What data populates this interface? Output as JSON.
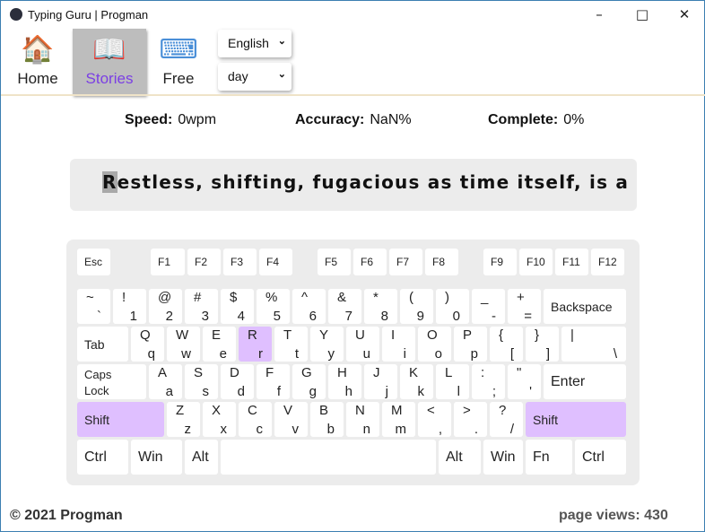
{
  "window": {
    "title": "Typing Guru | Progman",
    "icons": [
      "app-logo-icon",
      "minimize-icon",
      "maximize-icon",
      "close-icon"
    ]
  },
  "nav": [
    {
      "label": "Home",
      "icon": "house-icon",
      "glyph": "🏠",
      "active": false
    },
    {
      "label": "Stories",
      "icon": "storybook-icon",
      "glyph": "📖",
      "active": true
    },
    {
      "label": "Free",
      "icon": "keyboard-hands-icon",
      "glyph": "⌨",
      "active": false
    }
  ],
  "selects": {
    "language": "English",
    "theme": "day"
  },
  "stats": {
    "speed_label": "Speed:",
    "speed": "0wpm",
    "accuracy_label": "Accuracy:",
    "accuracy": "NaN%",
    "complete_label": "Complete:",
    "complete": "0%"
  },
  "text": {
    "current_char": "R",
    "rest": "estless, shifting, fugacious as time itself, is a"
  },
  "colors": {
    "highlight": "#dfbfff",
    "active_nav_text": "#7b3fe4",
    "cursor": "#a9a9a9"
  },
  "keyboard": {
    "rows": [
      [
        {
          "l": "Esc"
        },
        {
          "l": "F1"
        },
        {
          "l": "F2"
        },
        {
          "l": "F3"
        },
        {
          "l": "F4"
        },
        {
          "l": "F5"
        },
        {
          "l": "F6"
        },
        {
          "l": "F7"
        },
        {
          "l": "F8"
        },
        {
          "l": "F9"
        },
        {
          "l": "F10"
        },
        {
          "l": "F11"
        },
        {
          "l": "F12"
        }
      ],
      [
        {
          "t": "~",
          "b": "`"
        },
        {
          "t": "!",
          "b": "1"
        },
        {
          "t": "@",
          "b": "2"
        },
        {
          "t": "#",
          "b": "3"
        },
        {
          "t": "$",
          "b": "4"
        },
        {
          "t": "%",
          "b": "5"
        },
        {
          "t": "^",
          "b": "6"
        },
        {
          "t": "&",
          "b": "7"
        },
        {
          "t": "*",
          "b": "8"
        },
        {
          "t": "(",
          "b": "9"
        },
        {
          "t": ")",
          "b": "0"
        },
        {
          "t": "_",
          "b": "-"
        },
        {
          "t": "+",
          "b": "="
        },
        {
          "l": "Backspace"
        }
      ],
      [
        {
          "l": "Tab"
        },
        {
          "t": "Q",
          "b": "q"
        },
        {
          "t": "W",
          "b": "w"
        },
        {
          "t": "E",
          "b": "e"
        },
        {
          "t": "R",
          "b": "r",
          "hl": true
        },
        {
          "t": "T",
          "b": "t"
        },
        {
          "t": "Y",
          "b": "y"
        },
        {
          "t": "U",
          "b": "u"
        },
        {
          "t": "I",
          "b": "i"
        },
        {
          "t": "O",
          "b": "o"
        },
        {
          "t": "P",
          "b": "p"
        },
        {
          "t": "{",
          "b": "["
        },
        {
          "t": "}",
          "b": "]"
        },
        {
          "t": "|",
          "b": "\\"
        }
      ],
      [
        {
          "l": "Caps Lock"
        },
        {
          "t": "A",
          "b": "a"
        },
        {
          "t": "S",
          "b": "s"
        },
        {
          "t": "D",
          "b": "d"
        },
        {
          "t": "F",
          "b": "f"
        },
        {
          "t": "G",
          "b": "g"
        },
        {
          "t": "H",
          "b": "h"
        },
        {
          "t": "J",
          "b": "j"
        },
        {
          "t": "K",
          "b": "k"
        },
        {
          "t": "L",
          "b": "l"
        },
        {
          "t": ":",
          "b": ";"
        },
        {
          "t": "\"",
          "b": "'"
        },
        {
          "l": "Enter"
        }
      ],
      [
        {
          "l": "Shift",
          "hl": true
        },
        {
          "t": "Z",
          "b": "z"
        },
        {
          "t": "X",
          "b": "x"
        },
        {
          "t": "C",
          "b": "c"
        },
        {
          "t": "V",
          "b": "v"
        },
        {
          "t": "B",
          "b": "b"
        },
        {
          "t": "N",
          "b": "n"
        },
        {
          "t": "M",
          "b": "m"
        },
        {
          "t": "<",
          "b": ","
        },
        {
          "t": ">",
          "b": "."
        },
        {
          "t": "?",
          "b": "/"
        },
        {
          "l": "Shift",
          "hl": true
        }
      ],
      [
        {
          "l": "Ctrl"
        },
        {
          "l": "Win"
        },
        {
          "l": "Alt"
        },
        {
          "l": ""
        },
        {
          "l": "Alt"
        },
        {
          "l": "Win"
        },
        {
          "l": "Fn"
        },
        {
          "l": "Ctrl"
        }
      ]
    ]
  },
  "footer": {
    "copyright": "© 2021 Progman",
    "views_label": "page views:",
    "views": "430"
  }
}
